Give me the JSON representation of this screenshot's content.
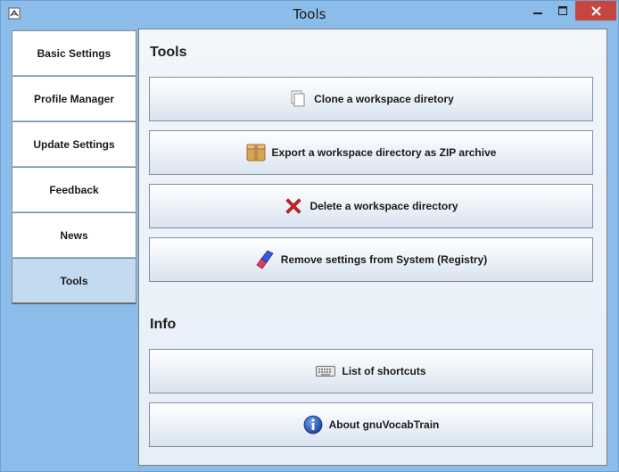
{
  "window": {
    "title": "Tools"
  },
  "sidebar": {
    "items": [
      {
        "label": "Basic Settings"
      },
      {
        "label": "Profile Manager"
      },
      {
        "label": "Update Settings"
      },
      {
        "label": "Feedback"
      },
      {
        "label": "News"
      },
      {
        "label": "Tools",
        "active": true
      }
    ]
  },
  "main": {
    "tools_title": "Tools",
    "tools": [
      {
        "label": "Clone a workspace diretory",
        "icon": "documents-icon"
      },
      {
        "label": "Export a workspace directory as ZIP archive",
        "icon": "box-icon"
      },
      {
        "label": "Delete a workspace directory",
        "icon": "red-x-icon"
      },
      {
        "label": "Remove settings from System (Registry)",
        "icon": "eraser-icon"
      }
    ],
    "info_title": "Info",
    "info": [
      {
        "label": "List of shortcuts",
        "icon": "keyboard-icon"
      },
      {
        "label": "About gnuVocabTrain",
        "icon": "info-icon"
      }
    ]
  },
  "colors": {
    "frame": "#8cbcea",
    "close_button": "#c7463f",
    "active_tab": "#c4daf1"
  }
}
